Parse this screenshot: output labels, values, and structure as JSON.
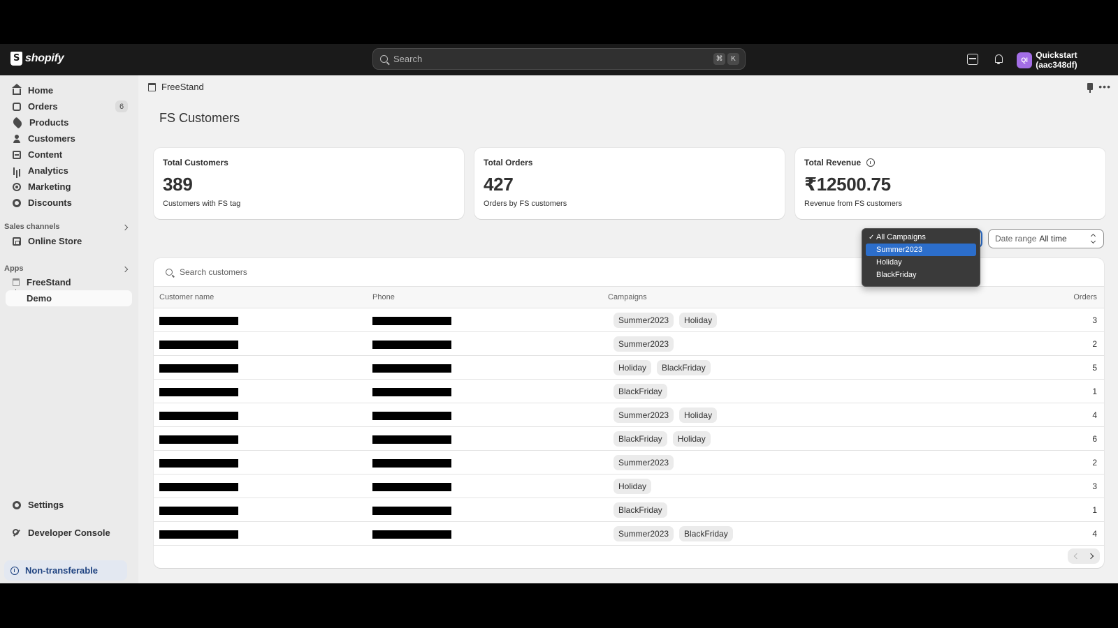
{
  "topbar": {
    "logo_text": "shopify",
    "search_placeholder": "Search",
    "shortcut_keys": [
      "⌘",
      "K"
    ],
    "avatar_initials": "QI",
    "account_name": "Quickstart (aac348df)",
    "avatar_color": "#a36ee6"
  },
  "sidebar": {
    "items": [
      {
        "label": "Home",
        "icon": "home-icon"
      },
      {
        "label": "Orders",
        "icon": "orders-icon",
        "badge": "6"
      },
      {
        "label": "Products",
        "icon": "tag-icon"
      },
      {
        "label": "Customers",
        "icon": "person-icon"
      },
      {
        "label": "Content",
        "icon": "content-icon"
      },
      {
        "label": "Analytics",
        "icon": "bar-chart-icon"
      },
      {
        "label": "Marketing",
        "icon": "target-icon"
      },
      {
        "label": "Discounts",
        "icon": "discount-icon"
      }
    ],
    "sales_channels_label": "Sales channels",
    "online_store_label": "Online Store",
    "apps_label": "Apps",
    "app_freestand": "FreeStand",
    "app_demo": "Demo",
    "settings_label": "Settings",
    "developer_console_label": "Developer Console",
    "non_transferable_label": "Non-transferable"
  },
  "main": {
    "breadcrumb": "FreeStand",
    "page_title": "FS Customers",
    "stats": [
      {
        "label": "Total Customers",
        "value": "389",
        "sub": "Customers with FS tag"
      },
      {
        "label": "Total Orders",
        "value": "427",
        "sub": "Orders by FS customers"
      },
      {
        "label": "Total Revenue",
        "value": "₹12500.75",
        "sub": "Revenue from FS customers"
      }
    ],
    "date_range": {
      "label": "Date range",
      "value": "All time"
    },
    "campaign_dropdown": {
      "options": [
        "All Campaigns",
        "Summer2023",
        "Holiday",
        "BlackFriday"
      ],
      "checked": "All Campaigns",
      "highlighted": "Summer2023"
    },
    "table": {
      "search_placeholder": "Search customers",
      "columns": [
        "Customer name",
        "Phone",
        "Campaigns",
        "Orders"
      ],
      "rows": [
        {
          "campaigns": [
            "Summer2023",
            "Holiday"
          ],
          "orders": "3"
        },
        {
          "campaigns": [
            "Summer2023"
          ],
          "orders": "2"
        },
        {
          "campaigns": [
            "Holiday",
            "BlackFriday"
          ],
          "orders": "5"
        },
        {
          "campaigns": [
            "BlackFriday"
          ],
          "orders": "1"
        },
        {
          "campaigns": [
            "Summer2023",
            "Holiday"
          ],
          "orders": "4"
        },
        {
          "campaigns": [
            "BlackFriday",
            "Holiday"
          ],
          "orders": "6"
        },
        {
          "campaigns": [
            "Summer2023"
          ],
          "orders": "2"
        },
        {
          "campaigns": [
            "Holiday"
          ],
          "orders": "3"
        },
        {
          "campaigns": [
            "BlackFriday"
          ],
          "orders": "1"
        },
        {
          "campaigns": [
            "Summer2023",
            "BlackFriday"
          ],
          "orders": "4"
        }
      ]
    }
  }
}
